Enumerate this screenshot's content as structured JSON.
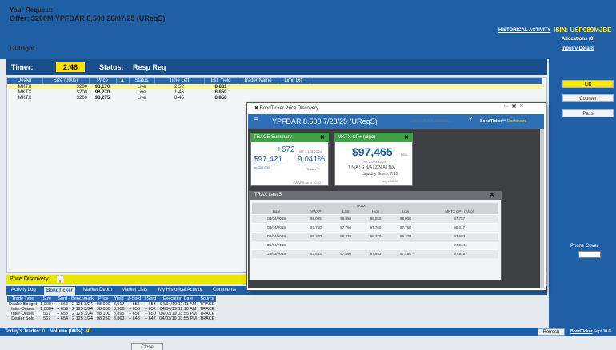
{
  "header": {
    "request_label": "Your Request:",
    "offer": "Offer: $200M YPFDAR 8,500 28/07/25 (URegS)",
    "mode": "Outright",
    "historical_activity": "HISTORICAL ACTIVITY",
    "isin": "ISIN: USP989MJBE",
    "allocations": "Allocations (0)",
    "inquiry_details": "Inquiry Details"
  },
  "timer": {
    "label": "Timer:",
    "value": "2:46",
    "status_label": "Status:",
    "status_value": "Resp Req"
  },
  "dealer_table": {
    "columns": [
      "Dealer",
      "Size (000s)",
      "Price",
      "",
      "Status",
      "Time Left",
      "Est. Yield",
      "Trader Name",
      "Limit Diff"
    ],
    "rows": [
      [
        "MKTX",
        "$200",
        "98,170",
        "",
        "Live",
        "2:52",
        "8,881",
        "",
        ""
      ],
      [
        "MKTX",
        "$200",
        "98,270",
        "",
        "Live",
        "1:46",
        "8,859",
        "",
        ""
      ],
      [
        "MKTX",
        "$200",
        "98,275",
        "",
        "Live",
        "8:45",
        "8,858",
        "",
        ""
      ]
    ]
  },
  "actions": {
    "lift": "Lift",
    "counter": "Counter",
    "pass": "Pass",
    "phone_cover": "Phone Cover"
  },
  "price_discovery": {
    "label": "Price Discovery",
    "tabs": [
      "Activity Log",
      "BondTicker",
      "Market Depth",
      "Market Lists",
      "My Historical Activity",
      "Comments"
    ],
    "active_tab": "BondTicker",
    "columns": [
      "Trade Type",
      "Size",
      "Sprd",
      "Benchmark",
      "Price",
      "Yield",
      "Z-Sprd",
      "I-Sprd",
      "Execution Date",
      "Source"
    ],
    "rows": [
      [
        "Dealer Bought",
        "1,000+",
        "+ 660",
        "2 125 3/24",
        "98,000",
        "8,917",
        "+ 654",
        "+ 653",
        "04/04/19 11:11 AM",
        "TRACE"
      ],
      [
        "Inter-Dealer",
        "1,000+",
        "+ 659",
        "2 125 3/24",
        "98,050",
        "8,906",
        "+ 653",
        "+ 652",
        "04/04/19 11:10 AM",
        "TRACE"
      ],
      [
        "Inter-Dealer",
        "567",
        "+ 658",
        "2 125 3/24",
        "98,100",
        "8,895",
        "+ 651",
        "+ 650",
        "04/03/19 03:55 PM",
        "TRACE"
      ],
      [
        "Dealer Sold",
        "567",
        "+ 654",
        "2 125 3/24",
        "98,250",
        "8,863",
        "+ 648",
        "+ 647",
        "04/03/19 03:55 PM",
        "TRACE"
      ]
    ]
  },
  "footer": {
    "todays_trades_label": "Today's Trades:",
    "todays_trades_value": "0",
    "volume_label": "Volume (000s):",
    "volume_value": "$0",
    "refresh": "Refresh",
    "bondticker": "BondTicker",
    "bondticker_suffix": "Sept 30 ©",
    "close": "Close"
  },
  "popup": {
    "title": "BondTicker Price Discovery",
    "security": "YPFDAR 8.500 7/28/25 (URegS)",
    "search_placeholder": "Search for bonds...",
    "brand": "BondTicker™",
    "brand_suffix": "Dashboard",
    "trace_card": {
      "title": "TRACE Summary",
      "change": "+672",
      "change_sub": "UST 2.125 03/24",
      "price": "$97,421",
      "yield": "9,041%",
      "size": "on 300,000",
      "trades": "Trades 7",
      "vwap": "VWAPS as of 10:22"
    },
    "mktx_card": {
      "title": "MKTX CP+ (algo)",
      "price": "$97,465",
      "unit": "USD",
      "ust": "UST 2.625 12/23",
      "tn": "T N/A | G N/A | Z N/A | N/A",
      "liquidity": "Liquidity Score: 7/10",
      "as_of": "as of 10:20"
    },
    "trax": {
      "title": "TRAX Last 5",
      "group_label": "TRAX",
      "columns": [
        "Date",
        "VWAP",
        "Last",
        "High",
        "Low",
        "MKTX CP+ (Algo)"
      ],
      "rows": [
        [
          "04/04/2019",
          "98,025",
          "98,050",
          "98,050",
          "98,000",
          "97,757"
        ],
        [
          "03/04/2019",
          "97,760",
          "97,760",
          "97,760",
          "97,760",
          "98,017"
        ],
        [
          "02/04/2019",
          "98,370",
          "98,370",
          "98,370",
          "98,370",
          "97,693"
        ],
        [
          "01/04/2019",
          "",
          "",
          "",
          "",
          "97,944"
        ],
        [
          "28/03/2019",
          "97,663",
          "97,460",
          "97,993",
          "97,460",
          "97,945"
        ]
      ]
    }
  },
  "colors": {
    "header_blue": "#1f5fa6",
    "highlight_yellow": "#ffe900",
    "card_green": "#40a048"
  }
}
